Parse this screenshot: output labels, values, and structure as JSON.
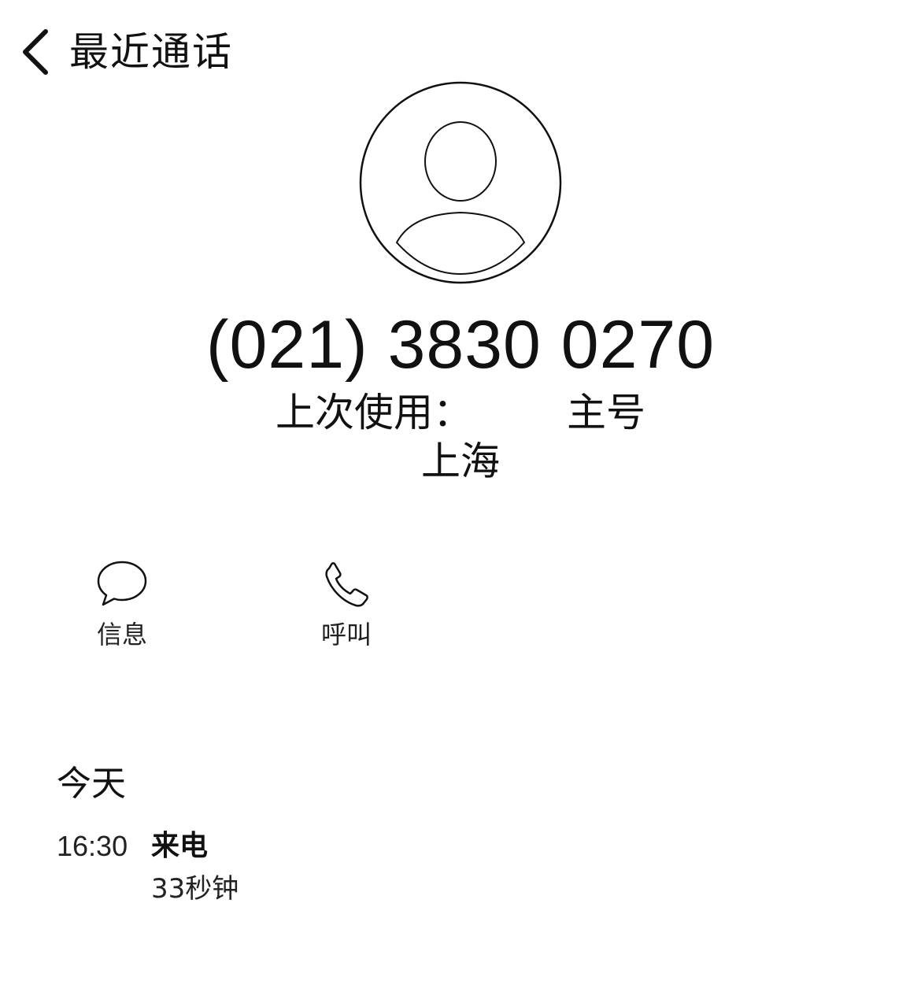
{
  "header": {
    "back_label": "最近通话"
  },
  "contact": {
    "number": "(021) 3830 0270",
    "last_used_prefix": "上次使用：",
    "line_name": "主号",
    "location": "上海"
  },
  "actions": [
    {
      "label": "信息",
      "icon": "message-bubble-icon",
      "enabled": true
    },
    {
      "label": "呼叫",
      "icon": "phone-icon",
      "enabled": true
    },
    {
      "label": "",
      "icon": "",
      "enabled": false
    },
    {
      "label": "",
      "icon": "",
      "enabled": false
    }
  ],
  "history": {
    "section_title": "今天",
    "entries": [
      {
        "time": "16:30",
        "type": "来电",
        "duration": "33秒钟"
      }
    ]
  }
}
